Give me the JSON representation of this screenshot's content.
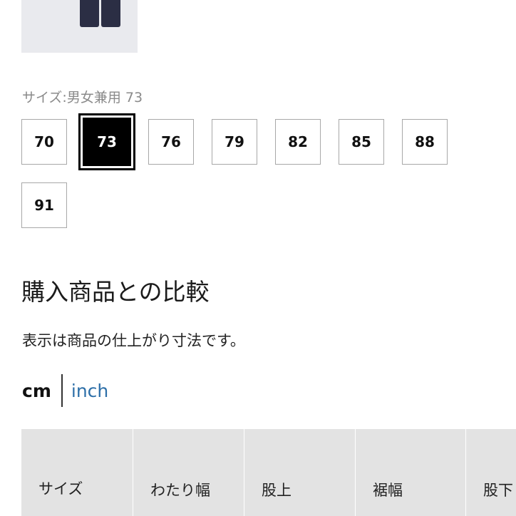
{
  "product": {
    "thumbnail_icon": "trousers-image"
  },
  "size_selector": {
    "caption": "サイズ:男女兼用 73",
    "options": [
      "70",
      "73",
      "76",
      "79",
      "82",
      "85",
      "88",
      "91"
    ],
    "selected": "73"
  },
  "comparison": {
    "title": "購入商品との比較",
    "note": "表示は商品の仕上がり寸法です。",
    "units": {
      "active": "cm",
      "other": "inch"
    },
    "table_headers": [
      "サイズ",
      "わたり幅",
      "股上",
      "裾幅",
      "股下"
    ]
  },
  "colors": {
    "link": "#2d6fa8",
    "selected_bg": "#000000",
    "table_header_bg": "#e3e3e3"
  }
}
